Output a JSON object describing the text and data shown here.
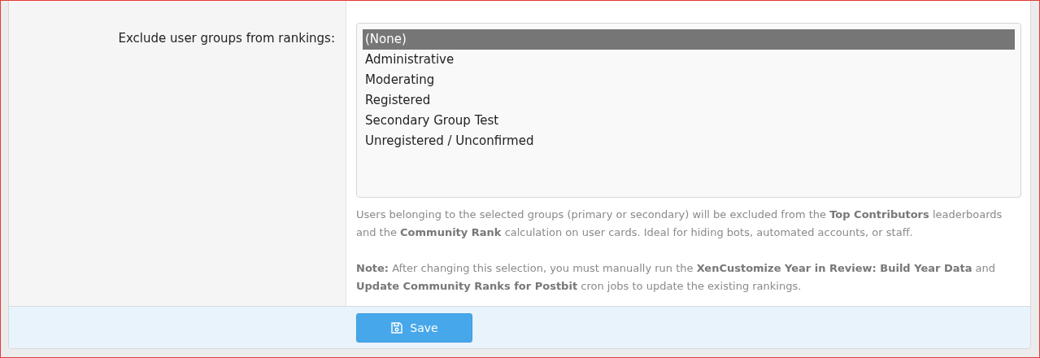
{
  "field": {
    "label": "Exclude user groups from rankings:",
    "options": [
      {
        "label": "(None)",
        "selected": true
      },
      {
        "label": "Administrative",
        "selected": false
      },
      {
        "label": "Moderating",
        "selected": false
      },
      {
        "label": "Registered",
        "selected": false
      },
      {
        "label": "Secondary Group Test",
        "selected": false
      },
      {
        "label": "Unregistered / Unconfirmed",
        "selected": false
      }
    ],
    "help": [
      "Users belonging to the selected groups (primary or secondary) will be excluded from the **Top Contributors** leaderboards and the **Community Rank** calculation on user cards. Ideal for hiding bots, automated accounts, or staff.",
      "**Note:** After changing this selection, you must manually run the **XenCustomize Year in Review: Build Year Data** and **Update Community Ranks for Postbit** cron jobs to update the existing rankings."
    ]
  },
  "footer": {
    "button": "Save"
  }
}
